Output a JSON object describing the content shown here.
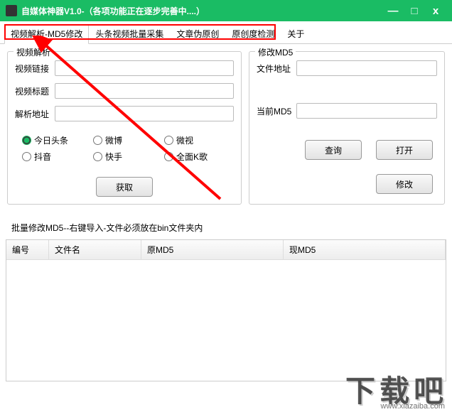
{
  "window": {
    "title": "自媒体神器V1.0-（各项功能正在逐步完善中....）",
    "minimize": "—",
    "maximize": "□",
    "close": "x"
  },
  "tabs": {
    "t0": "视频解析-MD5修改",
    "t1": "头条视频批量采集",
    "t2": "文章伪原创",
    "t3": "原创度检测",
    "t4": "关于"
  },
  "panel_parse": {
    "legend": "视频解析",
    "video_link_label": "视频链接",
    "video_link_value": "",
    "video_title_label": "视频标题",
    "video_title_value": "",
    "parse_addr_label": "解析地址",
    "parse_addr_value": "",
    "radios": {
      "r0": "今日头条",
      "r1": "微博",
      "r2": "微视",
      "r3": "抖音",
      "r4": "快手",
      "r5": "全面K歌"
    },
    "get_btn": "获取"
  },
  "panel_md5": {
    "legend": "修改MD5",
    "file_addr_label": "文件地址",
    "file_addr_value": "",
    "current_md5_label": "当前MD5",
    "current_md5_value": "",
    "query_btn": "查询",
    "open_btn": "打开",
    "modify_btn": "修改"
  },
  "batch": {
    "section_label": "批量修改MD5--右键导入-文件必须放在bin文件夹内",
    "col0": "编号",
    "col1": "文件名",
    "col2": "原MD5",
    "col3": "现MD5"
  },
  "watermark": {
    "text": "下载吧",
    "url": "www.xiazaiba.com"
  }
}
